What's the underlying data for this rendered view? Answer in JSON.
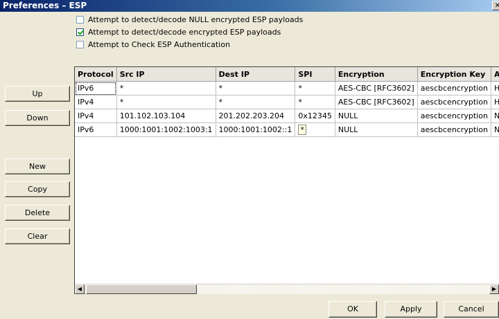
{
  "window": {
    "title": "Preferences – ESP",
    "close_glyph": "✕"
  },
  "options": [
    {
      "label": "Attempt to detect/decode NULL encrypted ESP payloads",
      "checked": false
    },
    {
      "label": "Attempt to detect/decode encrypted ESP payloads",
      "checked": true
    },
    {
      "label": "Attempt to Check ESP Authentication",
      "checked": false
    }
  ],
  "side_buttons": {
    "up": "Up",
    "down": "Down",
    "new": "New",
    "copy": "Copy",
    "delete": "Delete",
    "clear": "Clear"
  },
  "table": {
    "columns": [
      "Protocol",
      "Src IP",
      "Dest IP",
      "SPI",
      "Encryption",
      "Encryption Key",
      "Au"
    ],
    "rows": [
      [
        "IPv6",
        "*",
        "*",
        "*",
        "AES-CBC [RFC3602]",
        "aescbcencryption",
        "HM"
      ],
      [
        "IPv4",
        "*",
        "*",
        "*",
        "AES-CBC [RFC3602]",
        "aescbcencryption",
        "HM"
      ],
      [
        "IPv4",
        "101.102.103.104",
        "201.202.203.204",
        "0x12345",
        "NULL",
        "aescbcencryption",
        "NU"
      ],
      [
        "IPv6",
        "1000:1001:1002:1003:1",
        "1000:1001:1002::1",
        "*",
        "NULL",
        "aescbcencryption",
        "NU"
      ]
    ]
  },
  "scrollbar": {
    "left_glyph": "◀",
    "right_glyph": "▶"
  },
  "footer_buttons": {
    "ok": "OK",
    "apply": "Apply",
    "cancel": "Cancel"
  }
}
